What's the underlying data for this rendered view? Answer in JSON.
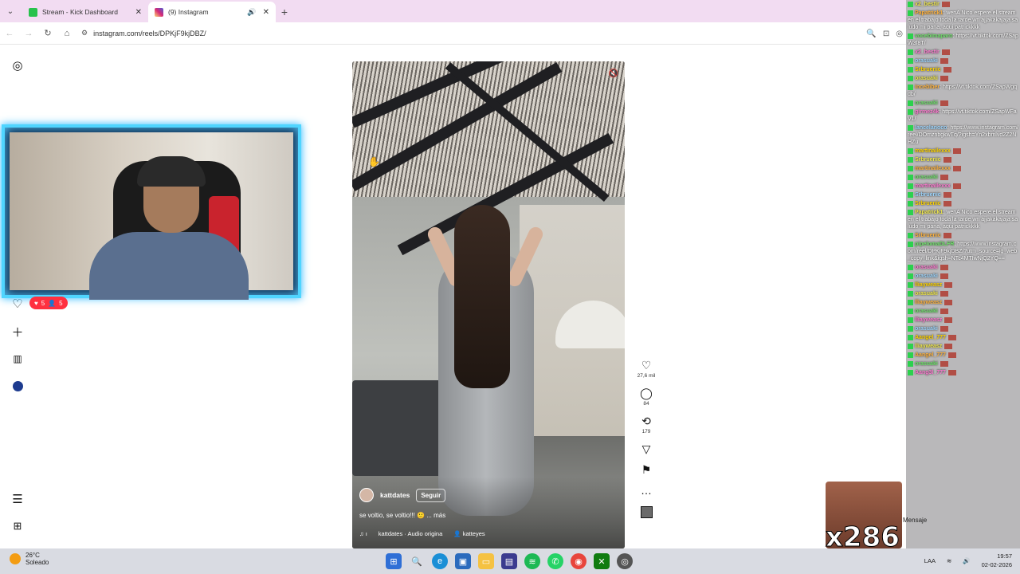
{
  "browser": {
    "tabs": [
      {
        "label": "Stream - Kick Dashboard",
        "favicon_color": "#27c24c"
      },
      {
        "label": "(9) Instagram",
        "favicon_color": "#d62976",
        "active": true
      }
    ],
    "url": "instagram.com/reels/DPKjF9kjDBZ/"
  },
  "reel": {
    "author": "kattdates",
    "follow_label": "Seguir",
    "caption": "se voltio, se voltio!!! 🙂 ... más",
    "audio": "kattdates · Audio origina",
    "tagged_user": "katteyes",
    "likes": "27,6 mil",
    "comments": "84",
    "reposts": "179"
  },
  "stream_overlay": {
    "hearts": "5",
    "viewers": "5",
    "sticker_text": "x286",
    "mensaje": "Mensaje"
  },
  "chat": {
    "messages": [
      {
        "user": "x2_bestir",
        "text": ""
      },
      {
        "user": "Papatrick1",
        "text": "wenA Nico espere el stream en el trabajo toda la tarde wn ajjakakajaja saludo mi pana, aqui patrickkkk"
      },
      {
        "user": "vocebimaparo",
        "text": "https://vt.tiktok.com/ZSapW3f8T/"
      },
      {
        "user": "x2_bestir",
        "text": ""
      },
      {
        "user": "orasuaki",
        "text": ""
      },
      {
        "user": "Srbruenic",
        "text": ""
      },
      {
        "user": "orasuaki",
        "text": ""
      },
      {
        "user": "incebiber",
        "text": "https://vt.tiktok.com/ZSapWgqdb/"
      },
      {
        "user": "orasuaki",
        "text": ""
      },
      {
        "user": "girmez4k",
        "text": "https://vt.tiktok.com/ZSapWFaV1/"
      },
      {
        "user": "lancelanoco",
        "text": "https://www.instagram.com/reel/DOmznbgkwTq/?igsh=Yn2xbmlvd2Z2NHZu"
      },
      {
        "user": "martinailexxx",
        "text": ""
      },
      {
        "user": "Srbruenic",
        "text": ""
      },
      {
        "user": "martinailexxx",
        "text": ""
      },
      {
        "user": "orasuaki",
        "text": ""
      },
      {
        "user": "martinailexxx",
        "text": ""
      },
      {
        "user": "Srbruenic",
        "text": ""
      },
      {
        "user": "Srbruenic",
        "text": ""
      },
      {
        "user": "Papatrick1",
        "text": "wenA Nico espere el stream en el trabajo toda la tarde wn ajjakakajaja saludo mi pana, aqui patrickkkk"
      },
      {
        "user": "Srbruenic",
        "text": ""
      },
      {
        "user": "pipelomaDLFR",
        "text": "https://www.instagram.com/reel/DPKjF9kjDBZ/?utm_source=ig_web_copy_link&igsh=NTc4MTIwNjQ2YQ=="
      },
      {
        "user": "orasuaki",
        "text": ""
      },
      {
        "user": "orasuaki",
        "text": ""
      },
      {
        "user": "lliayweasz",
        "text": ""
      },
      {
        "user": "orasuaki",
        "text": ""
      },
      {
        "user": "lliayweasz",
        "text": ""
      },
      {
        "user": "orasuaki",
        "text": ""
      },
      {
        "user": "lliayweasz",
        "text": ""
      },
      {
        "user": "orasuaki",
        "text": ""
      },
      {
        "user": "Aangel_777",
        "text": ""
      },
      {
        "user": "lliayweasz",
        "text": ""
      },
      {
        "user": "Aangel_777",
        "text": ""
      },
      {
        "user": "orasuaki",
        "text": ""
      },
      {
        "user": "Aang3l_777",
        "text": ""
      }
    ]
  },
  "taskbar": {
    "temperature": "26°C",
    "weather": "Soleado",
    "language": "LAA",
    "time": "19:57",
    "date": "02-02-2026"
  }
}
